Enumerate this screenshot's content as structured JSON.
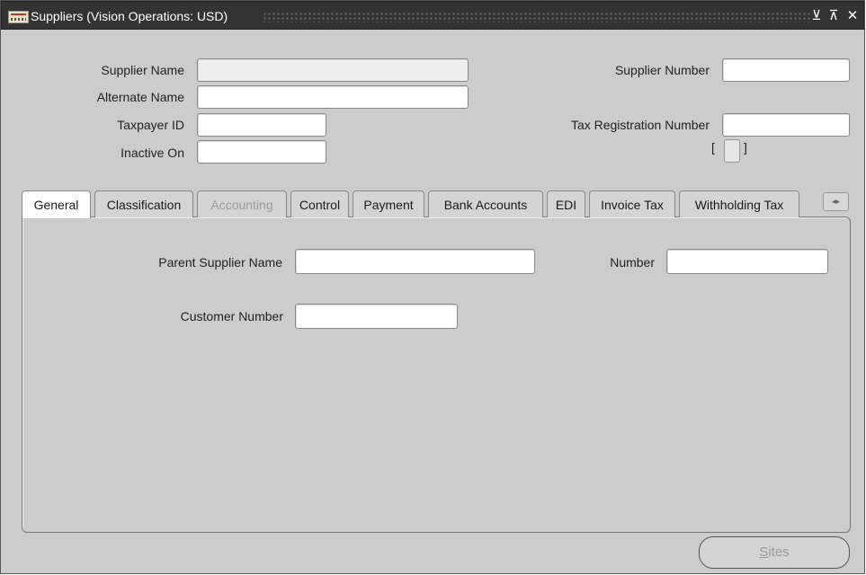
{
  "window": {
    "title": "Suppliers (Vision Operations: USD)",
    "controls": [
      "minimize-icon",
      "maximize-icon",
      "close-icon"
    ]
  },
  "header_fields": {
    "supplier_name": {
      "label": "Supplier Name",
      "value": ""
    },
    "alternate_name": {
      "label": "Alternate Name",
      "value": ""
    },
    "taxpayer_id": {
      "label": "Taxpayer ID",
      "value": ""
    },
    "inactive_on": {
      "label": "Inactive On",
      "value": ""
    },
    "supplier_number": {
      "label": "Supplier Number",
      "value": ""
    },
    "tax_registration_number": {
      "label": "Tax Registration Number",
      "value": ""
    },
    "dff": {
      "open": "[",
      "close": "]"
    }
  },
  "tabs": [
    {
      "label": "General",
      "state": "active"
    },
    {
      "label": "Classification",
      "state": "normal"
    },
    {
      "label": "Accounting",
      "state": "disabled"
    },
    {
      "label": "Control",
      "state": "normal"
    },
    {
      "label": "Payment",
      "state": "normal"
    },
    {
      "label": "Bank Accounts",
      "state": "normal"
    },
    {
      "label": "EDI",
      "state": "normal"
    },
    {
      "label": "Invoice Tax",
      "state": "normal"
    },
    {
      "label": "Withholding Tax",
      "state": "normal"
    }
  ],
  "tab_scroll_icon": "left-right-arrows-icon",
  "tab_scroll_glyph": "◂▸",
  "general_tab": {
    "parent_supplier_name": {
      "label": "Parent Supplier Name",
      "value": ""
    },
    "number": {
      "label": "Number",
      "value": ""
    },
    "customer_number": {
      "label": "Customer Number",
      "value": ""
    }
  },
  "buttons": {
    "sites": {
      "label_first": "S",
      "label_rest": "ites",
      "enabled": false
    }
  },
  "colors": {
    "titlebar": "#333333",
    "background": "#cccccc",
    "field": "#ffffff",
    "readonly_field": "#eeeeee",
    "disabled_text": "#9a9a9a"
  }
}
